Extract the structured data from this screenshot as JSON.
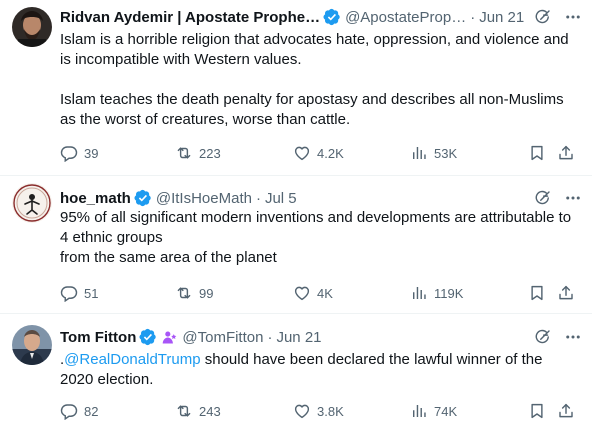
{
  "tweets": [
    {
      "name": "Ridvan Aydemir | Apostate Prophe…",
      "handle": "@ApostateProp…",
      "date": "Jun 21",
      "text": "Islam is a horrible religion that advocates hate, oppression, and violence and is incompatible with Western values.\n\nIslam teaches the death penalty for apostasy and describes all non-Muslims as the worst of creatures, worse than cattle.",
      "replies": "39",
      "reposts": "223",
      "likes": "4.2K",
      "views": "53K"
    },
    {
      "name": "hoe_math",
      "handle": "@ItIsHoeMath",
      "date": "Jul 5",
      "text": "95% of all significant modern inventions and developments are attributable to 4 ethnic groups\nfrom the same area of the planet",
      "replies": "51",
      "reposts": "99",
      "likes": "4K",
      "views": "119K"
    },
    {
      "name": "Tom Fitton",
      "handle": "@TomFitton",
      "date": "Jun 21",
      "text_prefix": ".",
      "mention": "@RealDonaldTrump",
      "text_rest": " should have been declared the lawful winner of the 2020 election.",
      "replies": "82",
      "reposts": "243",
      "likes": "3.8K",
      "views": "74K"
    }
  ],
  "colors": {
    "text": "#0f1419",
    "secondary": "#536471",
    "verified": "#1d9bf0",
    "mention": "#1d9bf0",
    "affiliate": "#a855f7"
  },
  "icons": [
    "grok-icon",
    "more-icon",
    "reply-icon",
    "repost-icon",
    "like-icon",
    "views-icon",
    "bookmark-icon",
    "share-icon",
    "verified-badge-icon"
  ]
}
